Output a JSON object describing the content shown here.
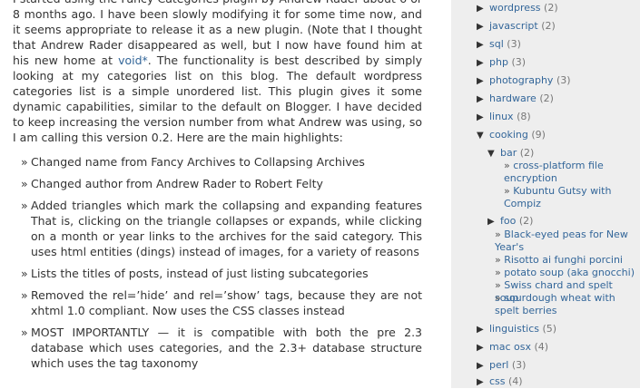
{
  "article": {
    "intro_before_link": "I started using the Fancy Categories plugin by Andrew Rader about 6 or 8 months ago. I have been slowly modifying it for some time now, and it seems appropriate to release it as a new plugin. (Note that I thought that Andrew Rader disappeared as well, but I now have found him at his new home at ",
    "link_text": "void*",
    "intro_after_link": ". The functionality is best described by simply looking at my categories list on this blog. The default wordpress categories list is a simple unordered list. This plugin gives it some dynamic capabilities, similar to the default on Blogger. I have decided to keep increasing the version number from what Andrew was using, so I am calling this version 0.2. Here are the main highlights:",
    "bullet": "»",
    "highlights": [
      "Changed name from Fancy Archives to Collapsing Archives",
      "Changed author from Andrew Rader to Robert Felty",
      "Added triangles which mark the collapsing and expanding features That is, clicking on the triangle collapses or expands, while clicking on a month or year links to the archives for the said category. This uses html entities (dings) instead of images, for a variety of reasons",
      "Lists the titles of posts, instead of just listing subcategories",
      "Removed the rel=’hide’ and rel=’show’ tags, because they are not xhtml 1.0 compliant. Now uses the CSS classes instead",
      "MOST IMPORTANTLY — it is compatible with both the pre 2.3 database which uses categories, and the 2.3+ database structure which uses the tag taxonomy"
    ]
  },
  "sidebar": {
    "expanded_symbol": "▼",
    "collapsed_symbol": "▶",
    "categories": [
      {
        "name": "wordpress",
        "count": "(2)"
      },
      {
        "name": "javascript",
        "count": "(2)"
      },
      {
        "name": "sql",
        "count": "(3)"
      },
      {
        "name": "php",
        "count": "(3)"
      },
      {
        "name": "photography",
        "count": "(3)"
      },
      {
        "name": "hardware",
        "count": "(2)"
      },
      {
        "name": "linux",
        "count": "(8)"
      },
      {
        "name": "cooking",
        "count": "(9)"
      },
      {
        "name": "linguistics",
        "count": "(5)"
      },
      {
        "name": "mac osx",
        "count": "(4)"
      },
      {
        "name": "perl",
        "count": "(3)"
      },
      {
        "name": "css",
        "count": "(4)"
      }
    ],
    "cooking_children": [
      {
        "name": "bar",
        "count": "(2)",
        "posts": [
          "cross-platform file encryption",
          "Kubuntu Gutsy with Compiz"
        ]
      },
      {
        "name": "foo",
        "count": "(2)",
        "posts": [
          "Black-eyed peas for New Year's",
          "Risotto ai funghi porcini",
          "potato soup (aka gnocchi)",
          "Swiss chard and spelt soup",
          "sourdough wheat with spelt berries"
        ]
      }
    ]
  }
}
